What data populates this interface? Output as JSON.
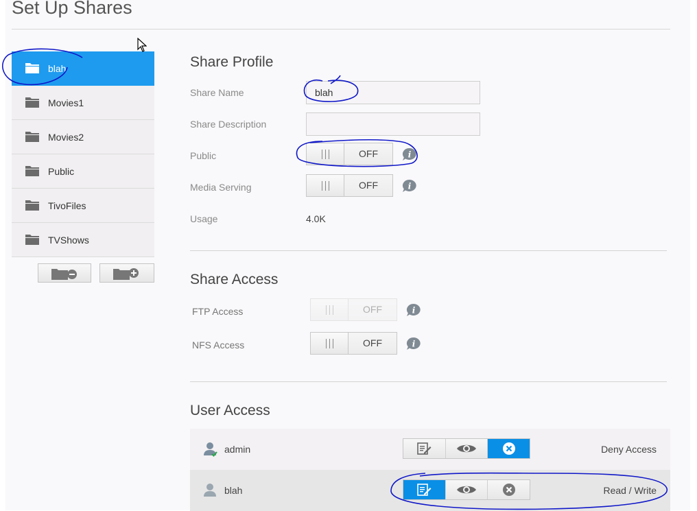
{
  "page": {
    "title": "Set Up Shares"
  },
  "shares": [
    {
      "label": "blah",
      "selected": true
    },
    {
      "label": "Movies1",
      "selected": false
    },
    {
      "label": "Movies2",
      "selected": false
    },
    {
      "label": "Public",
      "selected": false
    },
    {
      "label": "TivoFiles",
      "selected": false
    },
    {
      "label": "TVShows",
      "selected": false
    }
  ],
  "profile": {
    "title": "Share Profile",
    "share_name_label": "Share Name",
    "share_name_value": "blah",
    "share_description_label": "Share Description",
    "share_description_value": "",
    "public_label": "Public",
    "public_state": "OFF",
    "media_label": "Media Serving",
    "media_state": "OFF",
    "usage_label": "Usage",
    "usage_value": "4.0K"
  },
  "access": {
    "title": "Share Access",
    "ftp_label": "FTP Access",
    "ftp_state": "OFF",
    "nfs_label": "NFS Access",
    "nfs_state": "OFF"
  },
  "users": {
    "title": "User Access",
    "rows": [
      {
        "name": "admin",
        "permission": "Deny Access",
        "active": "deny"
      },
      {
        "name": "blah",
        "permission": "Read / Write",
        "active": "readwrite"
      }
    ]
  },
  "colors": {
    "accent": "#1e9bef",
    "active_button": "#0a8fe6",
    "annotation_ink": "#1018c8"
  }
}
